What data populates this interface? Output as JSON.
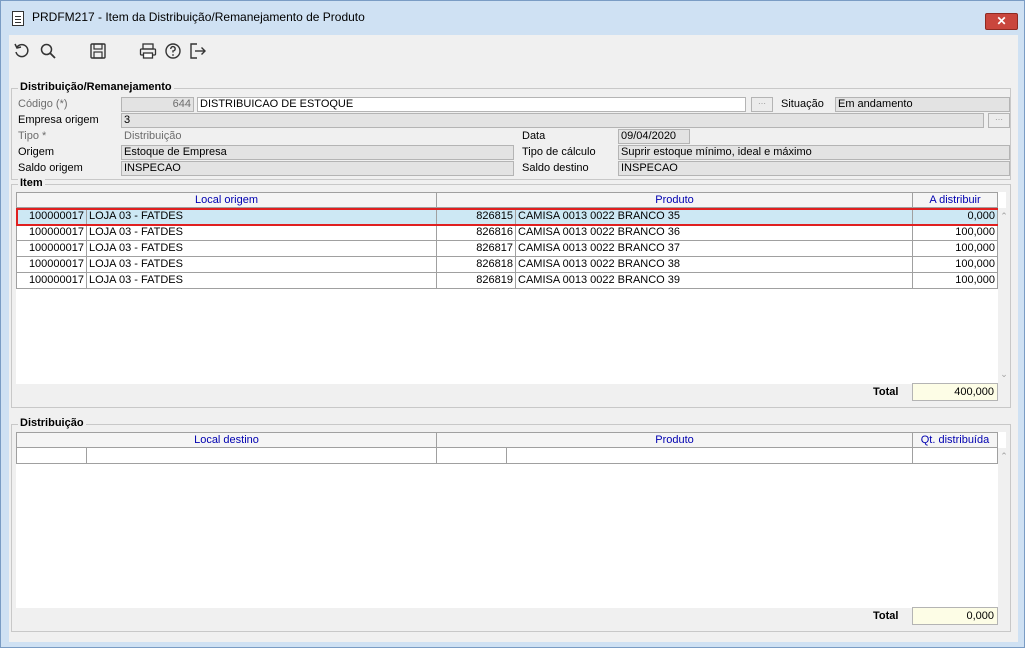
{
  "window": {
    "title": "PRDFM217 - Item da Distribuição/Remanejamento de Produto",
    "close_label": "✕"
  },
  "toolbar": {
    "buttons": [
      {
        "icon": "undo-icon"
      },
      {
        "icon": "search-icon"
      },
      {
        "icon": "save-icon"
      },
      {
        "icon": "print-icon"
      },
      {
        "icon": "help-icon"
      },
      {
        "icon": "exit-icon"
      }
    ]
  },
  "header": {
    "group_title": "Distribuição/Remanejamento",
    "codigo_label": "Código (*)",
    "codigo_value": "644",
    "descricao_value": "DISTRIBUICAO DE ESTOQUE",
    "situacao_label": "Situação",
    "situacao_value": "Em andamento",
    "empresa_label": "Empresa origem",
    "empresa_value": "3",
    "tipo_label": "Tipo *",
    "tipo_value": "Distribuição",
    "data_label": "Data",
    "data_value": "09/04/2020",
    "origem_label": "Origem",
    "origem_value": "Estoque de Empresa",
    "tipo_calculo_label": "Tipo de cálculo",
    "tipo_calculo_value": "Suprir estoque mínimo, ideal e máximo",
    "saldo_origem_label": "Saldo origem",
    "saldo_origem_value": "INSPECAO",
    "saldo_destino_label": "Saldo destino",
    "saldo_destino_value": "INSPECAO"
  },
  "item": {
    "group_title": "Item",
    "columns": [
      "Local origem",
      "Produto",
      "A distribuir"
    ],
    "rows": [
      {
        "local_code": "100000017",
        "local_name": "LOJA 03 - FATDES",
        "prod_code": "826815",
        "prod_name": "CAMISA 0013 0022 BRANCO  35",
        "qty": "0,000"
      },
      {
        "local_code": "100000017",
        "local_name": "LOJA 03 - FATDES",
        "prod_code": "826816",
        "prod_name": "CAMISA 0013 0022 BRANCO  36",
        "qty": "100,000"
      },
      {
        "local_code": "100000017",
        "local_name": "LOJA 03 - FATDES",
        "prod_code": "826817",
        "prod_name": "CAMISA 0013 0022 BRANCO  37",
        "qty": "100,000"
      },
      {
        "local_code": "100000017",
        "local_name": "LOJA 03 - FATDES",
        "prod_code": "826818",
        "prod_name": "CAMISA 0013 0022 BRANCO  38",
        "qty": "100,000"
      },
      {
        "local_code": "100000017",
        "local_name": "LOJA 03 - FATDES",
        "prod_code": "826819",
        "prod_name": "CAMISA 0013 0022 BRANCO  39",
        "qty": "100,000"
      }
    ],
    "selected_row": 0,
    "total_label": "Total",
    "total_value": "400,000"
  },
  "distribuicao": {
    "group_title": "Distribuição",
    "columns": [
      "Local destino",
      "Produto",
      "Qt. distribuída"
    ],
    "total_label": "Total",
    "total_value": "0,000"
  },
  "colors": {
    "selection_outline": "#e02020",
    "selection_fill": "#cde8f4",
    "header_text": "#0000b0",
    "total_fill": "#fdfde6"
  }
}
